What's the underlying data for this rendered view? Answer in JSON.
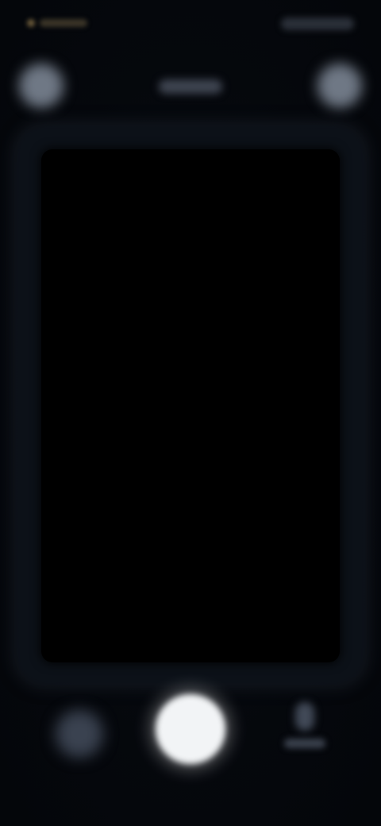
{
  "colors": {
    "background": "#05080d",
    "viewfinder": "#000000",
    "shutter": "#f2f4f6",
    "status_accent": "#6b5a3a"
  },
  "icons": {
    "top_left": "flash-icon",
    "top_right": "settings-icon",
    "bottom_left": "gallery-thumbnail-icon",
    "bottom_center": "shutter-icon",
    "bottom_right": "camera-switch-icon"
  }
}
